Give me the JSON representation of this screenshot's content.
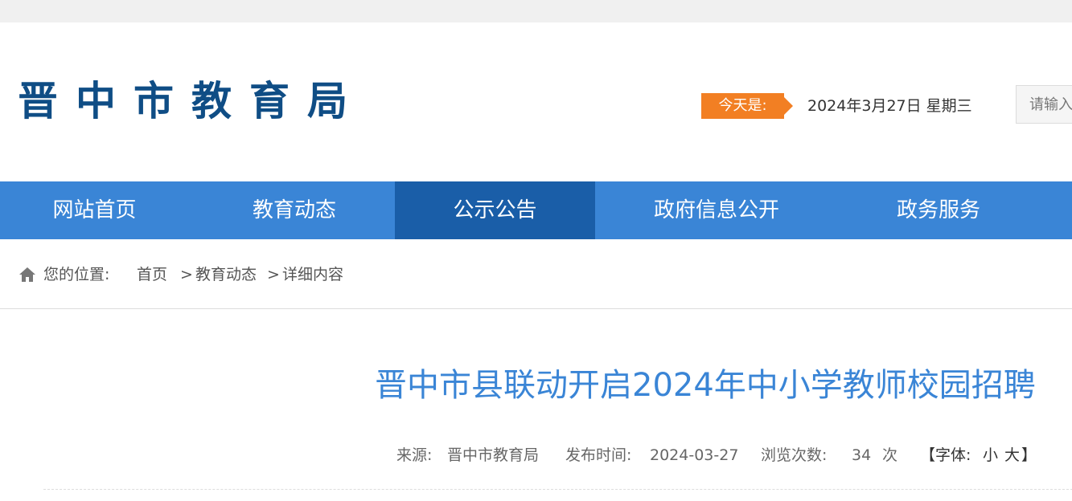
{
  "header": {
    "site_title": "晋中市教育局",
    "today_label": "今天是:",
    "today_date": "2024年3月27日 星期三",
    "search_placeholder": "请输入"
  },
  "nav": {
    "items": [
      {
        "label": "网站首页"
      },
      {
        "label": "教育动态"
      },
      {
        "label": "公示公告"
      },
      {
        "label": "政府信息公开"
      },
      {
        "label": "政务服务"
      }
    ],
    "active_index": 2
  },
  "breadcrumb": {
    "icon": "home-icon",
    "prefix": "您的位置:",
    "home": "首页",
    "sep1": ">",
    "category": "教育动态",
    "sep2": ">",
    "current": "详细内容"
  },
  "article": {
    "title": "晋中市县联动开启2024年中小学教师校园招聘",
    "source_label": "来源:",
    "source": "晋中市教育局",
    "published_label": "发布时间:",
    "published": "2024-03-27",
    "views_label": "浏览次数:",
    "views": "34",
    "views_unit": "次",
    "font_open": "【字体:",
    "font_small": "小",
    "font_large": "大",
    "font_close": "】"
  },
  "colors": {
    "brand_blue": "#0f4d85",
    "nav_blue": "#3a85d6",
    "nav_active": "#1a5ea8",
    "accent_orange": "#f27f23"
  }
}
